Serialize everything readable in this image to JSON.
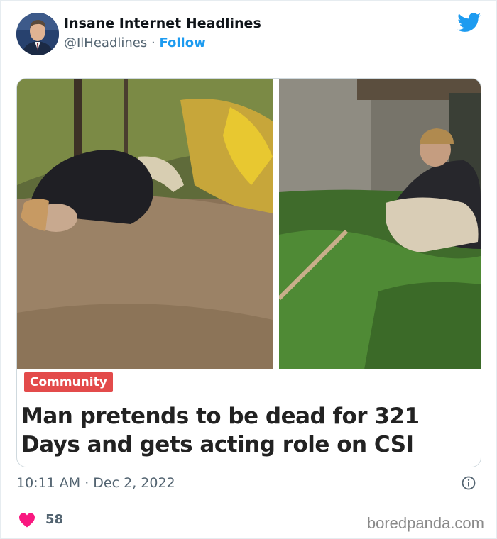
{
  "author": {
    "name": "Insane Internet Headlines",
    "handle": "@IlHeadlines",
    "separator": "·",
    "follow_label": "Follow"
  },
  "icons": {
    "avatar": "avatar-portrait",
    "platform": "twitter-bird-icon",
    "info": "info-icon",
    "like": "heart-icon"
  },
  "card": {
    "tag": "Community",
    "headline": "Man pretends to be dead for 321 Days and gets acting role on CSI"
  },
  "tweet": {
    "time": "10:11 AM · Dec 2, 2022",
    "likes": "58"
  },
  "watermark": "boredpanda.com",
  "colors": {
    "twitter_blue": "#1d9bf0",
    "like_red": "#f91880",
    "tag_red": "#e34b4b"
  }
}
